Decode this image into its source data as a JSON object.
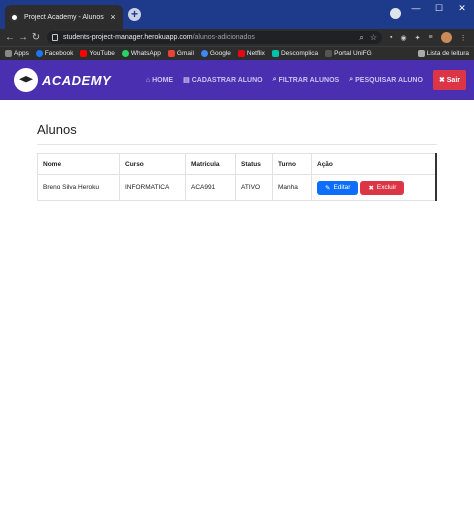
{
  "browser": {
    "tab_title": "Project Academy - Alunos",
    "url_host": "students-project-manager.herokuapp.com",
    "url_path": "/alunos-adicionados",
    "bookmarks": [
      "Apps",
      "Facebook",
      "YouTube",
      "WhatsApp",
      "Gmail",
      "Google",
      "Netflix",
      "Descomplica",
      "Portal UniFG"
    ],
    "bookmark_colors": [
      "#888888",
      "#1877f2",
      "#ff0000",
      "#25d366",
      "#ea4335",
      "#4285f4",
      "#e50914",
      "#00c2a8",
      "#333333"
    ],
    "reading_list": "Lista de leitura"
  },
  "navbar": {
    "logo_text": "ACADEMY",
    "links": [
      "HOME",
      "CADASTRAR ALUNO",
      "FILTRAR ALUNOS",
      "PESQUISAR ALUNO"
    ],
    "logout_label": "Sair"
  },
  "page": {
    "title": "Alunos"
  },
  "table": {
    "headers": [
      "Nome",
      "Curso",
      "Matricula",
      "Status",
      "Turno",
      "Ação"
    ],
    "rows": [
      {
        "nome": "Breno Silva Heroku",
        "curso": "INFORMATICA",
        "matricula": "ACA991",
        "status": "ATIVO",
        "turno": "Manha",
        "edit_label": "Editar",
        "delete_label": "Excluir"
      }
    ]
  },
  "colors": {
    "navbar": "#4a2fb0",
    "primary": "#0d6efd",
    "danger": "#dc3545"
  }
}
